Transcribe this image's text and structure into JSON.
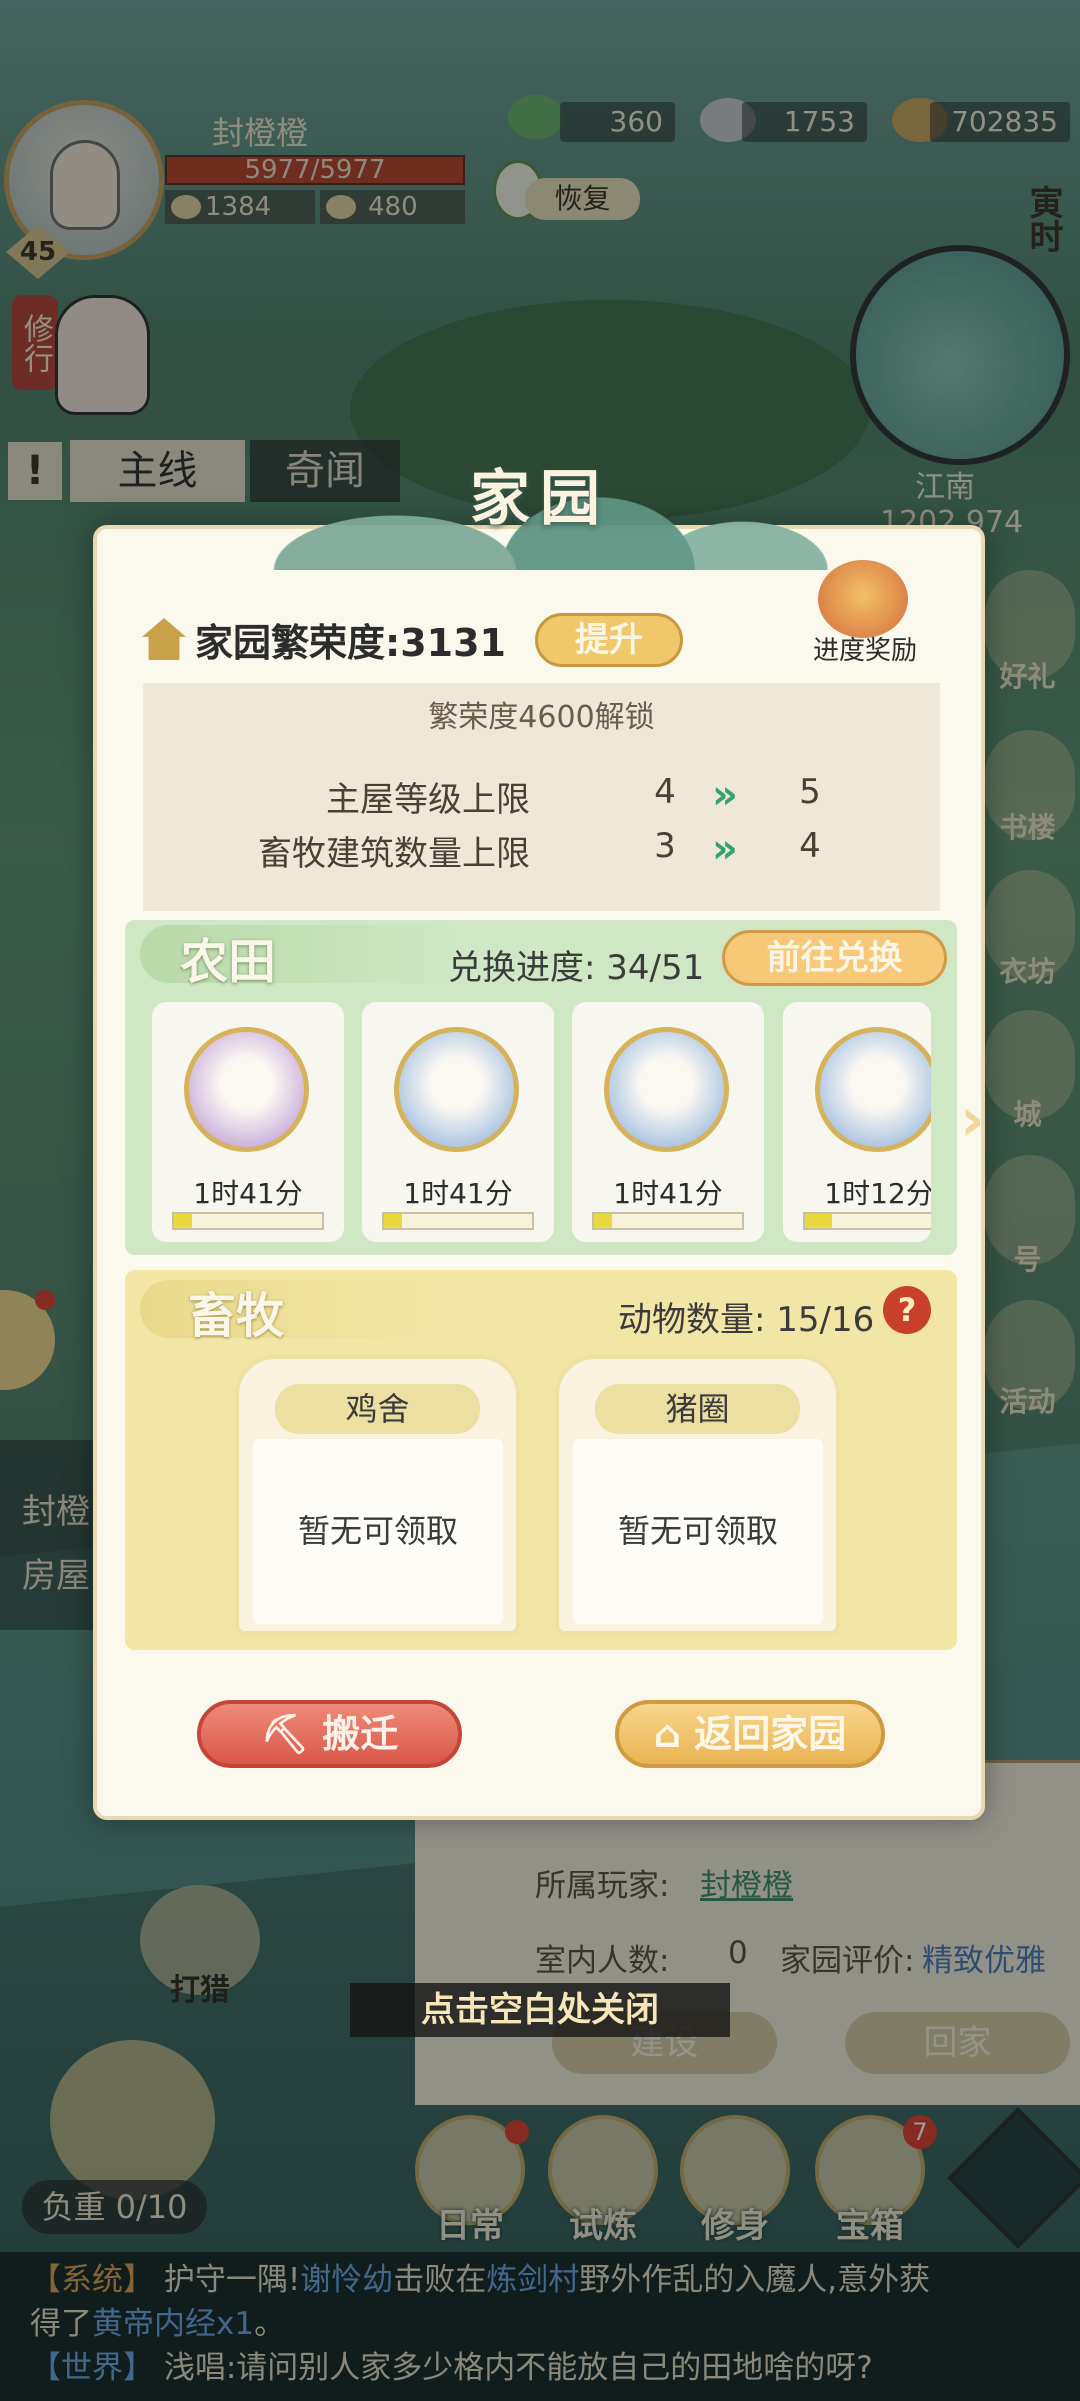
{
  "player": {
    "name": "封橙橙",
    "level": "45",
    "hp": "5977/5977",
    "stat_a": "1384",
    "stat_b": "480",
    "cultivate_label": "修行"
  },
  "currencies": [
    {
      "value": "360"
    },
    {
      "value": "1753"
    },
    {
      "value": "702835"
    }
  ],
  "restore_label": "恢复",
  "time_tag": "寅时",
  "map": {
    "region": "江南",
    "coords": "1202,974"
  },
  "tabs": {
    "main": "主线",
    "odd": "奇闻"
  },
  "side_left_lines": [
    "封橙",
    "房屋"
  ],
  "right_menu": [
    "好礼",
    "书楼",
    "衣坊",
    "城",
    "号",
    "活动"
  ],
  "dialog": {
    "title": "家园",
    "prosperity_label": "家园繁荣度:3131",
    "upgrade_button": "提升",
    "progress_reward": "进度奖励",
    "unlock": {
      "title": "繁荣度4600解锁",
      "rows": [
        {
          "label": "主屋等级上限",
          "from": "4",
          "to": "5"
        },
        {
          "label": "畜牧建筑数量上限",
          "from": "3",
          "to": "4"
        }
      ]
    },
    "farm": {
      "title": "农田",
      "progress": "兑换进度: 34/51",
      "exchange_button": "前往兑换",
      "crops": [
        {
          "icon": "mushroom-icon",
          "time": "1时41分",
          "progress": 0.12,
          "color": "#b28ad0"
        },
        {
          "icon": "eggplant-icon",
          "time": "1时41分",
          "progress": 0.12,
          "color": "#7fa8d8"
        },
        {
          "icon": "eggplant-icon",
          "time": "1时41分",
          "progress": 0.12,
          "color": "#7fa8d8"
        },
        {
          "icon": "cabbage-icon",
          "time": "1时12分",
          "progress": 0.18,
          "color": "#7fa8d8"
        }
      ]
    },
    "ranch": {
      "title": "畜牧",
      "animal_count": "动物数量: 15/16",
      "pens": [
        {
          "name": "鸡舍",
          "status": "暂无可领取"
        },
        {
          "name": "猪圈",
          "status": "暂无可领取"
        }
      ]
    },
    "move_button": "搬迁",
    "return_button": "返回家园"
  },
  "close_hint": "点击空白处关闭",
  "under_panel": {
    "owner_label": "所属玩家:",
    "owner": "封橙橙",
    "people_label": "室内人数:",
    "people": "0",
    "rating_label": "家园评价:",
    "rating": "精致优雅",
    "build_button": "建设",
    "home_button": "回家"
  },
  "hunt_label": "打猎",
  "load_label": "负重 0/10",
  "bottom_nav": [
    {
      "label": "日常"
    },
    {
      "label": "试炼"
    },
    {
      "label": "修身"
    },
    {
      "label": "宝箱",
      "badge": "7"
    }
  ],
  "chat": {
    "line1_channel": "【系统】",
    "line1_pre": "护守一隅!",
    "line1_name": "谢怜幼",
    "line1_mid": "击败在",
    "line1_place": "炼剑村",
    "line1_post": "野外作乱的入魔人,意外获",
    "line2_pre": "得了",
    "line2_item": "黄帝内经x1",
    "line2_post": "。",
    "line3_channel": "【世界】",
    "line3_text": "浅唱:请问别人家多少格内不能放自己的田地啥的呀?"
  }
}
